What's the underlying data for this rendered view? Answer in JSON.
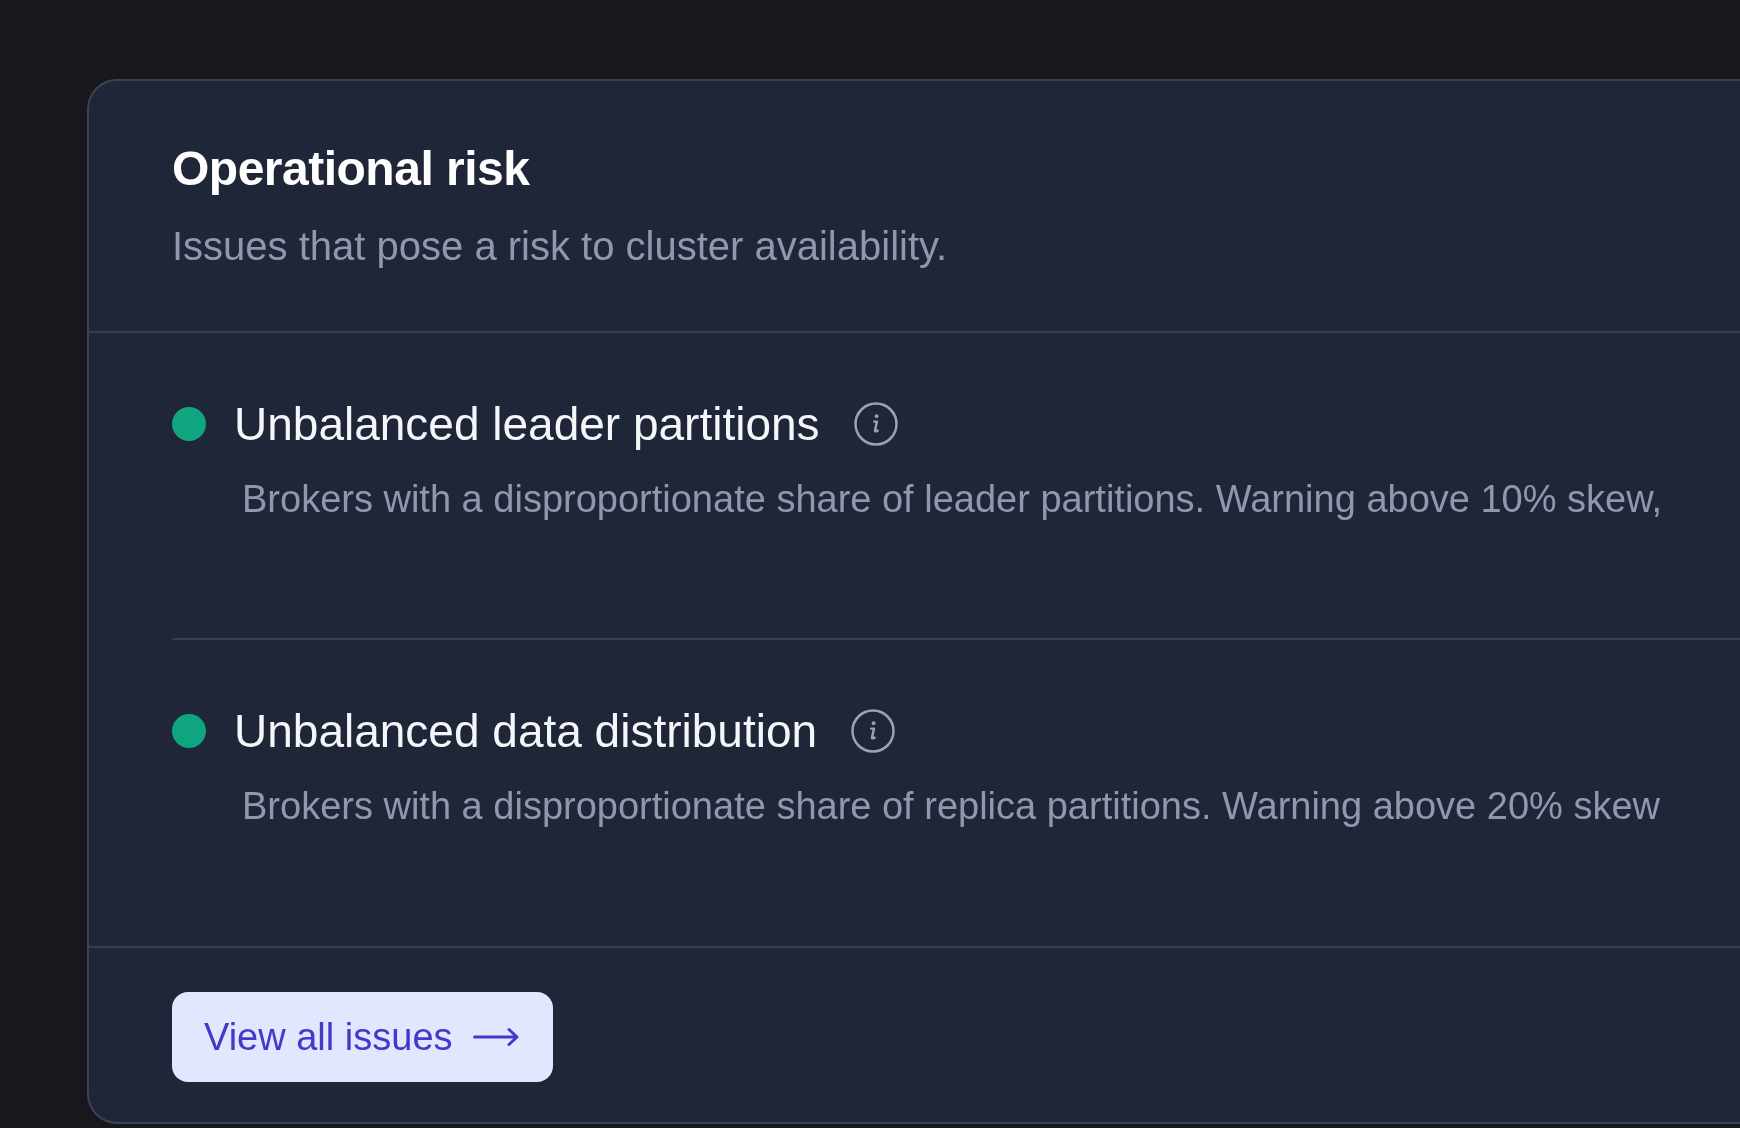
{
  "panel": {
    "title": "Operational risk",
    "subtitle": "Issues that pose a risk to cluster availability.",
    "issues": [
      {
        "name": "Unbalanced leader partitions",
        "color": "#0fa67f",
        "description": "Brokers with a disproportionate share of leader partitions. Warning above 10% skew,"
      },
      {
        "name": "Unbalanced data distribution",
        "color": "#0fa67f",
        "description": "Brokers with a disproportionate share of replica partitions. Warning above 20% skew"
      }
    ],
    "action": {
      "label": "View all issues"
    }
  }
}
